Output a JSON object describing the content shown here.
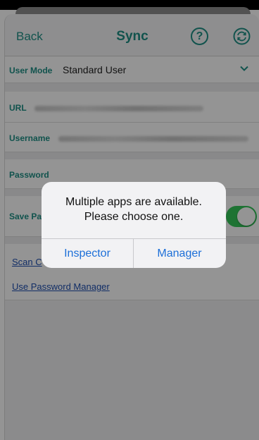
{
  "nav": {
    "back_label": "Back",
    "title": "Sync",
    "help_glyph": "?",
    "help_icon": "help-icon",
    "sync_icon": "sync-icon"
  },
  "user_mode": {
    "label": "User Mode",
    "value": "Standard User",
    "icon": "chevron-down-icon"
  },
  "url": {
    "label": "URL"
  },
  "username": {
    "label": "Username"
  },
  "password": {
    "label": "Password"
  },
  "save_password": {
    "label": "Save Pa",
    "toggle_on": true
  },
  "links": {
    "scan": "Scan C",
    "password_manager": "Use Password Manager"
  },
  "alert": {
    "message_line1": "Multiple apps are available.",
    "message_line2": "Please choose one.",
    "option_inspector": "Inspector",
    "option_manager": "Manager"
  },
  "colors": {
    "accent": "#1e8f86",
    "toggle_on": "#34c759",
    "link": "#1e4fb0",
    "alert_button": "#1c6fd8"
  }
}
